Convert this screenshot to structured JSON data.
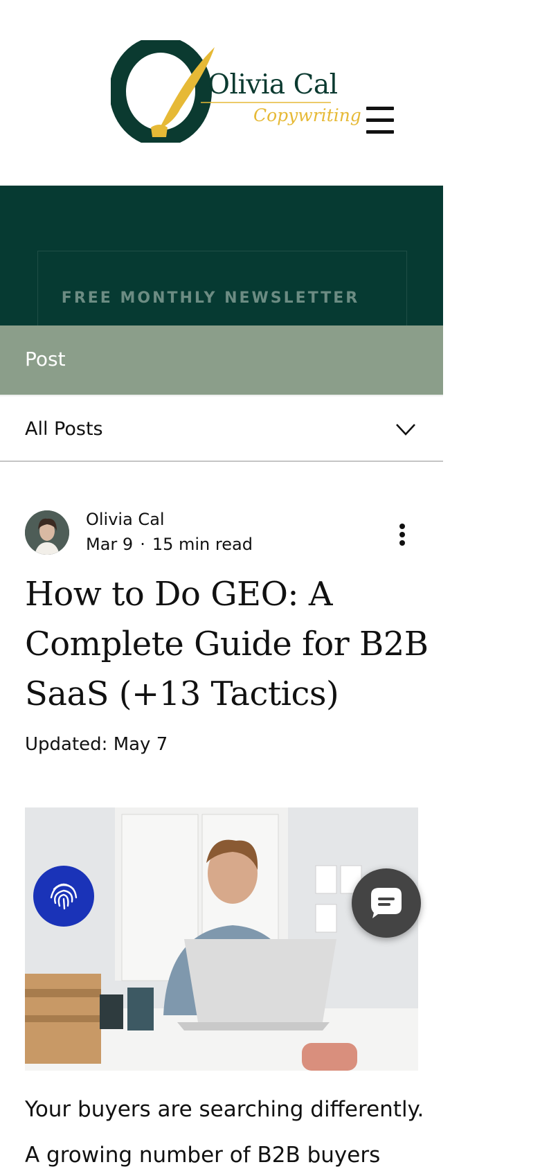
{
  "brand": {
    "name": "Olivia Cal",
    "tagline": "Copywriting",
    "colors": {
      "green": "#0b3a30",
      "gold": "#e6b936"
    }
  },
  "header": {
    "menu_icon": "hamburger-menu-icon"
  },
  "banner": {
    "text": "FREE MONTHLY NEWSLETTER",
    "background": "#063a32"
  },
  "post_bar": {
    "label": "Post",
    "background": "#8b9e8a"
  },
  "filter": {
    "selected": "All Posts",
    "icon": "chevron-down-icon"
  },
  "post": {
    "author": "Olivia Cal",
    "date": "Mar 9",
    "separator": "·",
    "read_time": "15 min read",
    "more_icon": "more-vertical-icon",
    "title": "How to Do GEO: A Complete Guide for B2B SaaS (+13 Tactics)",
    "updated": "Updated: May 7",
    "body": [
      "Your buyers are searching differently.",
      "A growing number of B2B buyers"
    ]
  },
  "floating": {
    "fingerprint_icon": "fingerprint-icon",
    "chat_icon": "chat-bubble-icon",
    "colors": {
      "fingerprint_bg": "#1a33b8",
      "chat_bg": "#444444"
    }
  }
}
